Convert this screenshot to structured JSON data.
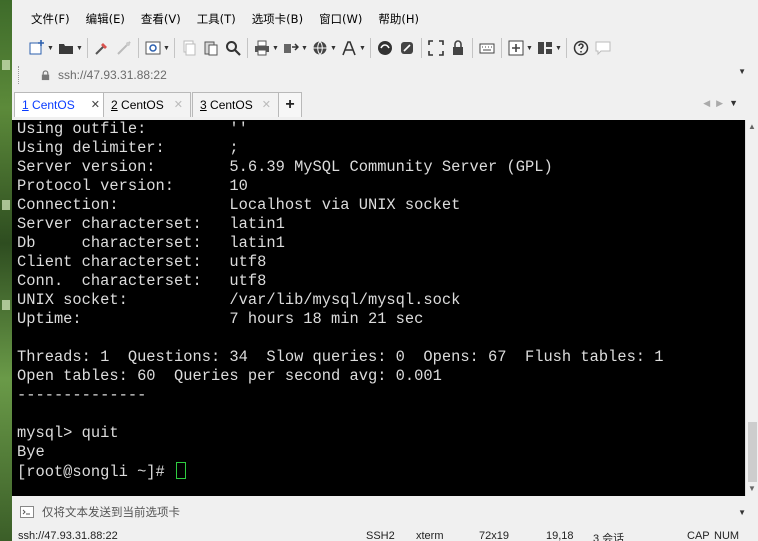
{
  "menu": [
    "文件(F)",
    "编辑(E)",
    "查看(V)",
    "工具(T)",
    "选项卡(B)",
    "窗口(W)",
    "帮助(H)"
  ],
  "address": {
    "text": "ssh://47.93.31.88:22"
  },
  "tabs": [
    {
      "num": "1",
      "name": " CentOS",
      "active": true
    },
    {
      "num": "2",
      "name": " CentOS",
      "active": false
    },
    {
      "num": "3",
      "name": " CentOS",
      "active": false
    }
  ],
  "terminal": {
    "lines": [
      "Using outfile:         ''",
      "Using delimiter:       ;",
      "Server version:        5.6.39 MySQL Community Server (GPL)",
      "Protocol version:      10",
      "Connection:            Localhost via UNIX socket",
      "Server characterset:   latin1",
      "Db     characterset:   latin1",
      "Client characterset:   utf8",
      "Conn.  characterset:   utf8",
      "UNIX socket:           /var/lib/mysql/mysql.sock",
      "Uptime:                7 hours 18 min 21 sec",
      "",
      "Threads: 1  Questions: 34  Slow queries: 0  Opens: 67  Flush tables: 1",
      "Open tables: 60  Queries per second avg: 0.001",
      "--------------",
      "",
      "mysql> quit",
      "Bye"
    ],
    "prompt": "[root@songli ~]# "
  },
  "sendbar": {
    "text": "仅将文本发送到当前选项卡"
  },
  "status": {
    "address": "ssh://47.93.31.88:22",
    "protocol": "SSH2",
    "term": "xterm",
    "size": "72x19",
    "cursor": "19,18",
    "sessions": "3 会话",
    "caps": "CAP",
    "num": "NUM"
  },
  "colors": {
    "active_tab": "#0a3cff",
    "cursor": "#2ecc40",
    "terminal_bg": "#000000",
    "terminal_fg": "#dcdcdc"
  }
}
